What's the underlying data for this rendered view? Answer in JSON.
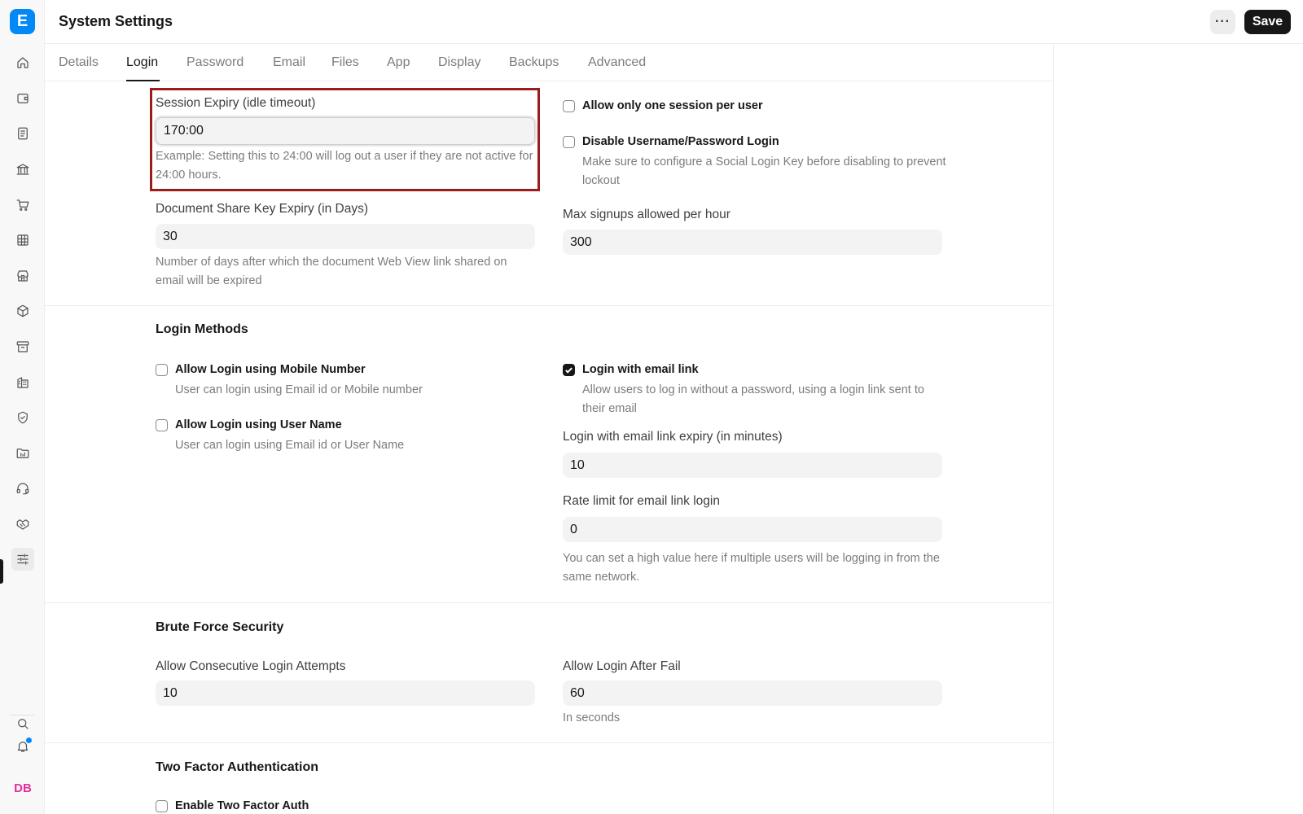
{
  "app": {
    "logo_letter": "E"
  },
  "sidebar": {
    "icons": [
      "home-icon",
      "wallet-icon",
      "document-icon",
      "bank-icon",
      "cart-icon",
      "table-icon",
      "store-icon",
      "box-icon",
      "archive-icon",
      "building-icon",
      "shield-icon",
      "folder-icon",
      "headset-icon",
      "handshake-icon",
      "sliders-icon"
    ],
    "active": "sliders-icon",
    "avatar_initials": "DB"
  },
  "header": {
    "title": "System Settings",
    "more_label": "···",
    "save_label": "Save"
  },
  "tabs": [
    {
      "label": "Details"
    },
    {
      "label": "Login",
      "active": true
    },
    {
      "label": "Password"
    },
    {
      "label": "Email"
    },
    {
      "label": "Files"
    },
    {
      "label": "App"
    },
    {
      "label": "Display"
    },
    {
      "label": "Backups"
    },
    {
      "label": "Advanced"
    }
  ],
  "session": {
    "session_expiry_label": "Session Expiry (idle timeout)",
    "session_expiry_value": "170:00",
    "session_expiry_help": "Example: Setting this to 24:00 will log out a user if they are not active for 24:00 hours.",
    "share_key_label": "Document Share Key Expiry (in Days)",
    "share_key_value": "30",
    "share_key_help": "Number of days after which the document Web View link shared on email will be expired",
    "one_session_label": "Allow only one session per user",
    "one_session_checked": false,
    "disable_login_label": "Disable Username/Password Login",
    "disable_login_checked": false,
    "disable_login_help": "Make sure to configure a Social Login Key before disabling to prevent lockout",
    "max_signups_label": "Max signups allowed per hour",
    "max_signups_value": "300"
  },
  "login_methods": {
    "title": "Login Methods",
    "mobile_label": "Allow Login using Mobile Number",
    "mobile_checked": false,
    "mobile_help": "User can login using Email id or Mobile number",
    "username_label": "Allow Login using User Name",
    "username_checked": false,
    "username_help": "User can login using Email id or User Name",
    "email_link_label": "Login with email link",
    "email_link_checked": true,
    "email_link_help": "Allow users to log in without a password, using a login link sent to their email",
    "email_link_expiry_label": "Login with email link expiry (in minutes)",
    "email_link_expiry_value": "10",
    "rate_limit_label": "Rate limit for email link login",
    "rate_limit_value": "0",
    "rate_limit_help": "You can set a high value here if multiple users will be logging in from the same network."
  },
  "brute_force": {
    "title": "Brute Force Security",
    "attempts_label": "Allow Consecutive Login Attempts",
    "attempts_value": "10",
    "after_fail_label": "Allow Login After Fail",
    "after_fail_value": "60",
    "after_fail_help": "In seconds"
  },
  "two_factor": {
    "title": "Two Factor Authentication",
    "enable_label": "Enable Two Factor Auth",
    "enable_checked": false
  }
}
